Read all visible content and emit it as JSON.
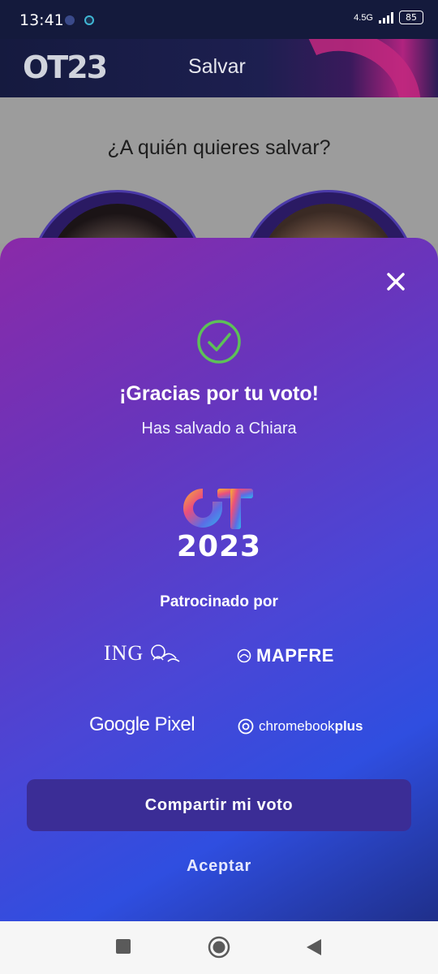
{
  "status_bar": {
    "time": "13:41",
    "network": "4.5G",
    "battery": "85"
  },
  "app_bar": {
    "logo": "OT23",
    "title": "Salvar"
  },
  "background": {
    "question": "¿A quién quieres salvar?"
  },
  "dialog": {
    "thanks": "¡Gracias por tu voto!",
    "saved_text": "Has salvado a Chiara",
    "year": "2023",
    "sponsored_label": "Patrocinado por",
    "sponsors": {
      "ing": "ING",
      "mapfre": "MAPFRE",
      "google": "Google Pixel",
      "chromebook": "chromebook",
      "chromebook_plus": "plus"
    },
    "share_button": "Compartir mi voto",
    "accept_button": "Aceptar"
  },
  "colors": {
    "accent_check": "#5dc157",
    "sheet_start": "#8a2aa8",
    "sheet_end": "#2f4ee0",
    "share_button": "#3b2d96"
  },
  "icons": [
    "close-icon",
    "check-circle-icon",
    "ing-lion-icon",
    "mapfre-icon",
    "chrome-icon",
    "nav-recents-icon",
    "nav-home-icon",
    "nav-back-icon"
  ]
}
